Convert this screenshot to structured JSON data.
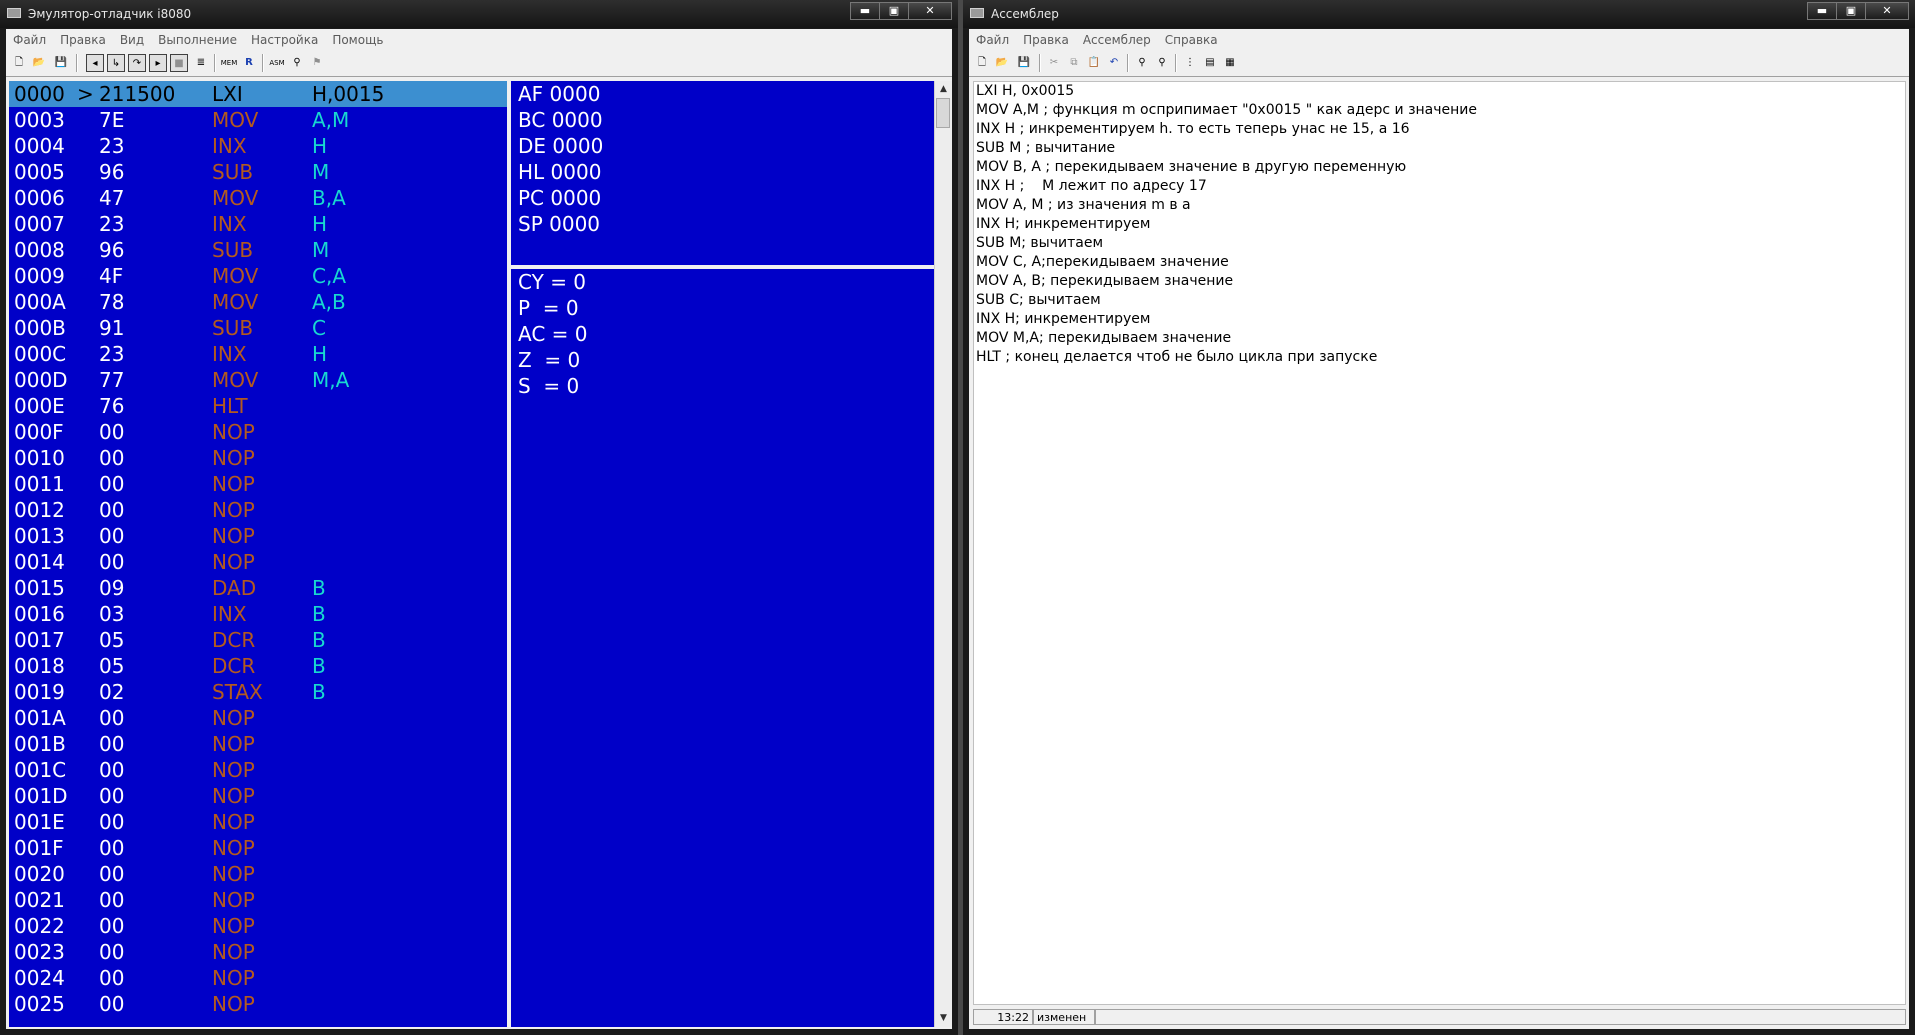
{
  "emulator": {
    "title": "Эмулятор-отладчик i8080",
    "menu": [
      "Файл",
      "Правка",
      "Вид",
      "Выполнение",
      "Настройка",
      "Помощь"
    ],
    "toolbar": [
      "new-icon",
      "open-icon",
      "save-icon",
      "step-back-icon",
      "step-into-icon",
      "step-over-icon",
      "run-icon",
      "stop-icon",
      "memory-icon",
      "mem-label",
      "registers-icon",
      "asm-icon",
      "binoculars-icon",
      "breakpoint-icon"
    ],
    "toolbar_text": {
      "mem": "MEM",
      "rf": "R",
      "asm": "ASM"
    },
    "code": [
      {
        "addr": "0000",
        "mark": ">",
        "hex": "211500",
        "mn": "LXI",
        "op": "H,0015"
      },
      {
        "addr": "0003",
        "mark": "",
        "hex": "7E",
        "mn": "MOV",
        "op": "A,M"
      },
      {
        "addr": "0004",
        "mark": "",
        "hex": "23",
        "mn": "INX",
        "op": "H"
      },
      {
        "addr": "0005",
        "mark": "",
        "hex": "96",
        "mn": "SUB",
        "op": "M"
      },
      {
        "addr": "0006",
        "mark": "",
        "hex": "47",
        "mn": "MOV",
        "op": "B,A"
      },
      {
        "addr": "0007",
        "mark": "",
        "hex": "23",
        "mn": "INX",
        "op": "H"
      },
      {
        "addr": "0008",
        "mark": "",
        "hex": "96",
        "mn": "SUB",
        "op": "M"
      },
      {
        "addr": "0009",
        "mark": "",
        "hex": "4F",
        "mn": "MOV",
        "op": "C,A"
      },
      {
        "addr": "000A",
        "mark": "",
        "hex": "78",
        "mn": "MOV",
        "op": "A,B"
      },
      {
        "addr": "000B",
        "mark": "",
        "hex": "91",
        "mn": "SUB",
        "op": "C"
      },
      {
        "addr": "000C",
        "mark": "",
        "hex": "23",
        "mn": "INX",
        "op": "H"
      },
      {
        "addr": "000D",
        "mark": "",
        "hex": "77",
        "mn": "MOV",
        "op": "M,A"
      },
      {
        "addr": "000E",
        "mark": "",
        "hex": "76",
        "mn": "HLT",
        "op": ""
      },
      {
        "addr": "000F",
        "mark": "",
        "hex": "00",
        "mn": "NOP",
        "op": ""
      },
      {
        "addr": "0010",
        "mark": "",
        "hex": "00",
        "mn": "NOP",
        "op": ""
      },
      {
        "addr": "0011",
        "mark": "",
        "hex": "00",
        "mn": "NOP",
        "op": ""
      },
      {
        "addr": "0012",
        "mark": "",
        "hex": "00",
        "mn": "NOP",
        "op": ""
      },
      {
        "addr": "0013",
        "mark": "",
        "hex": "00",
        "mn": "NOP",
        "op": ""
      },
      {
        "addr": "0014",
        "mark": "",
        "hex": "00",
        "mn": "NOP",
        "op": ""
      },
      {
        "addr": "0015",
        "mark": "",
        "hex": "09",
        "mn": "DAD",
        "op": "B"
      },
      {
        "addr": "0016",
        "mark": "",
        "hex": "03",
        "mn": "INX",
        "op": "B"
      },
      {
        "addr": "0017",
        "mark": "",
        "hex": "05",
        "mn": "DCR",
        "op": "B"
      },
      {
        "addr": "0018",
        "mark": "",
        "hex": "05",
        "mn": "DCR",
        "op": "B"
      },
      {
        "addr": "0019",
        "mark": "",
        "hex": "02",
        "mn": "STAX",
        "op": "B"
      },
      {
        "addr": "001A",
        "mark": "",
        "hex": "00",
        "mn": "NOP",
        "op": ""
      },
      {
        "addr": "001B",
        "mark": "",
        "hex": "00",
        "mn": "NOP",
        "op": ""
      },
      {
        "addr": "001C",
        "mark": "",
        "hex": "00",
        "mn": "NOP",
        "op": ""
      },
      {
        "addr": "001D",
        "mark": "",
        "hex": "00",
        "mn": "NOP",
        "op": ""
      },
      {
        "addr": "001E",
        "mark": "",
        "hex": "00",
        "mn": "NOP",
        "op": ""
      },
      {
        "addr": "001F",
        "mark": "",
        "hex": "00",
        "mn": "NOP",
        "op": ""
      },
      {
        "addr": "0020",
        "mark": "",
        "hex": "00",
        "mn": "NOP",
        "op": ""
      },
      {
        "addr": "0021",
        "mark": "",
        "hex": "00",
        "mn": "NOP",
        "op": ""
      },
      {
        "addr": "0022",
        "mark": "",
        "hex": "00",
        "mn": "NOP",
        "op": ""
      },
      {
        "addr": "0023",
        "mark": "",
        "hex": "00",
        "mn": "NOP",
        "op": ""
      },
      {
        "addr": "0024",
        "mark": "",
        "hex": "00",
        "mn": "NOP",
        "op": ""
      },
      {
        "addr": "0025",
        "mark": "",
        "hex": "00",
        "mn": "NOP",
        "op": ""
      }
    ],
    "registers": [
      "AF 0000",
      "BC 0000",
      "DE 0000",
      "HL 0000",
      "PC 0000",
      "SP 0000"
    ],
    "flags": [
      "CY = 0",
      "P  = 0",
      "AC = 0",
      "Z  = 0",
      "S  = 0"
    ],
    "colors": {
      "pane_bg": "#0000c8",
      "selection": "#3c8fd0",
      "mnemonic": "#b35a1f",
      "operand": "#18d8d0"
    }
  },
  "assembler": {
    "title": "Ассемблер",
    "menu": [
      "Файл",
      "Правка",
      "Ассемблер",
      "Справка"
    ],
    "lines": [
      "LXI H, 0x0015",
      "MOV A,M ; функция m осприпимает \"0x0015 \" как адерс и значение",
      "INX H ; инкрементируем h. то есть теперь унас не 15, а 16",
      "SUB M ; вычитание",
      "MOV B, A ; перекидываем значение в другую переменную",
      "INX H ;    M лежит по адресу 17",
      "MOV A, M ; из значения m в а",
      "INX H; инкрементируем",
      "SUB M; вычитаем",
      "MOV C, A;перекидываем значение",
      "MOV A, B; перекидываем значение",
      "SUB C; вычитаем",
      "INX H; инкрементируем",
      "MOV M,A; перекидываем значение",
      "HLT ; конец делается чтоб не было цикла при запуске"
    ],
    "status": {
      "position": "13:22",
      "state": "изменен"
    }
  },
  "window_buttons": {
    "minimize": "▬",
    "maximize": "▣",
    "close": "✕"
  }
}
